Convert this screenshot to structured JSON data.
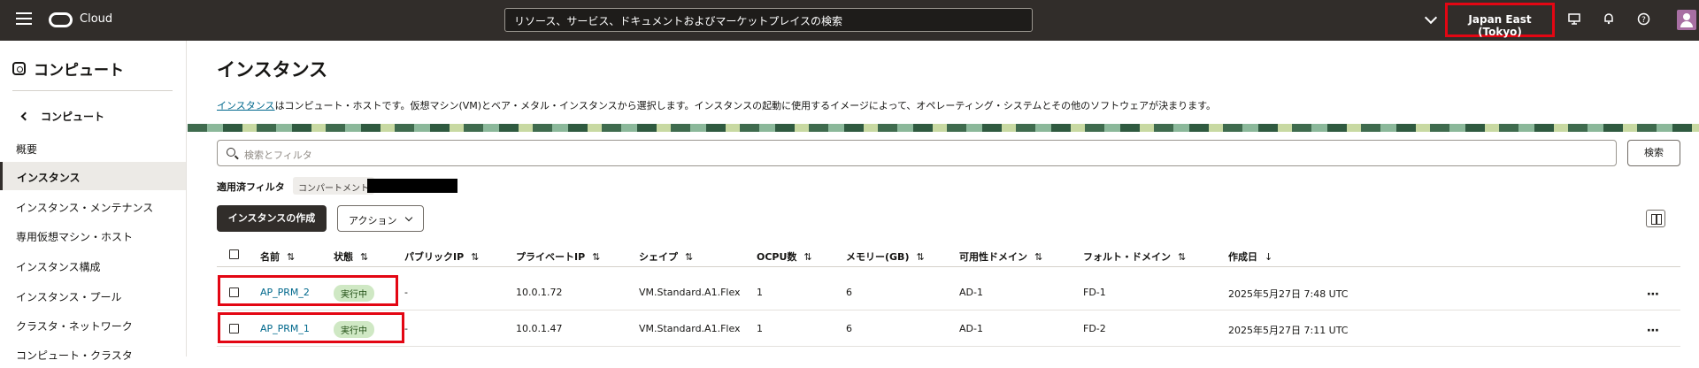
{
  "topbar": {
    "brand": "Cloud",
    "search_placeholder": "リソース、サービス、ドキュメントおよびマーケットプレイスの検索",
    "region": "Japan East (Tokyo)"
  },
  "sidebar": {
    "title": "コンピュート",
    "back_label": "コンピュート",
    "items": [
      {
        "label": "概要"
      },
      {
        "label": "インスタンス"
      },
      {
        "label": "インスタンス・メンテナンス"
      },
      {
        "label": "専用仮想マシン・ホスト"
      },
      {
        "label": "インスタンス構成"
      },
      {
        "label": "インスタンス・プール"
      },
      {
        "label": "クラスタ・ネットワーク"
      },
      {
        "label": "コンピュート・クラスタ"
      }
    ]
  },
  "main": {
    "title": "インスタンス",
    "description_link": "インスタンス",
    "description_rest": "はコンピュート・ホストです。仮想マシン(VM)とベア・メタル・インスタンスから選択します。インスタンスの起動に使用するイメージによって、オペレーティング・システムとその他のソフトウェアが決まります。",
    "filter_placeholder": "検索とフィルタ",
    "search_button": "検索",
    "applied_filters_label": "適用済フィルタ",
    "compartment_chip": "コンパートメント",
    "create_button": "インスタンスの作成",
    "actions_button": "アクション"
  },
  "table": {
    "columns": [
      "名前",
      "状態",
      "パブリックIP",
      "プライベートIP",
      "シェイプ",
      "OCPU数",
      "メモリー(GB)",
      "可用性ドメイン",
      "フォルト・ドメイン",
      "作成日"
    ],
    "sort_icons": [
      "⇅",
      "⇅",
      "⇅",
      "⇅",
      "⇅",
      "⇅",
      "⇅",
      "⇅",
      "⇅",
      "↓"
    ],
    "rows": [
      {
        "name": "AP_PRM_2",
        "state": "実行中",
        "public_ip": "-",
        "private_ip": "10.0.1.72",
        "shape": "VM.Standard.A1.Flex",
        "ocpu": "1",
        "memory": "6",
        "ad": "AD-1",
        "fd": "FD-1",
        "created": "2025年5月27日 7:48 UTC"
      },
      {
        "name": "AP_PRM_1",
        "state": "実行中",
        "public_ip": "-",
        "private_ip": "10.0.1.47",
        "shape": "VM.Standard.A1.Flex",
        "ocpu": "1",
        "memory": "6",
        "ad": "AD-1",
        "fd": "FD-2",
        "created": "2025年5月27日 7:11 UTC"
      }
    ]
  },
  "colors": {
    "topbar_bg": "#312d2a",
    "link": "#00688c",
    "highlight": "#e30613",
    "running_badge": "#cfe8c4"
  },
  "icons": [
    "menu-icon",
    "oracle-logo-icon",
    "chevron-down-icon",
    "monitor-icon",
    "bell-icon",
    "help-icon",
    "avatar-icon",
    "compute-icon",
    "chevron-left-icon",
    "search-icon",
    "panel-icon",
    "more-icon"
  ]
}
